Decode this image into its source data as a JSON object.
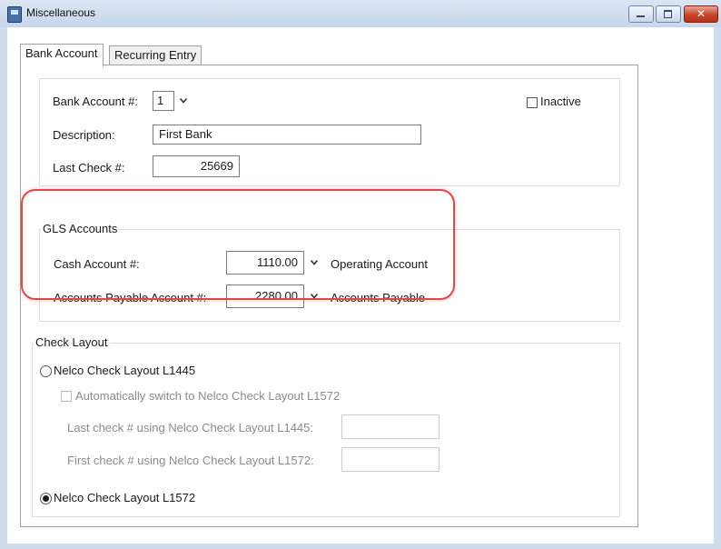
{
  "window": {
    "title": "Miscellaneous",
    "close_glyph": "✕"
  },
  "tabs": [
    {
      "label": "Bank Account"
    },
    {
      "label": "Recurring Entry"
    }
  ],
  "bank": {
    "account_label": "Bank Account #:",
    "account_value": "1",
    "inactive_label": "Inactive",
    "description_label": "Description:",
    "description_value": "First Bank",
    "last_check_label": "Last Check #:",
    "last_check_value": "25669"
  },
  "gls": {
    "title": "GLS Accounts",
    "cash_label": "Cash Account #:",
    "cash_value": "1110.00",
    "cash_name": "Operating Account",
    "ap_label": "Accounts Payable Account #:",
    "ap_value": "2280.00",
    "ap_name": "Accounts Payable"
  },
  "check_layout": {
    "title": "Check Layout",
    "option1": "Nelco Check Layout L1445",
    "auto_switch": "Automatically switch to Nelco Check Layout L1572",
    "last_check_label": "Last check # using Nelco Check Layout L1445:",
    "first_check_label": "First check # using Nelco Check Layout L1572:",
    "option2": "Nelco Check Layout L1572",
    "selected": "Nelco Check Layout L1572"
  },
  "colors": {
    "highlight": "#de4a4a",
    "titlebar": "#c6d6ea"
  }
}
